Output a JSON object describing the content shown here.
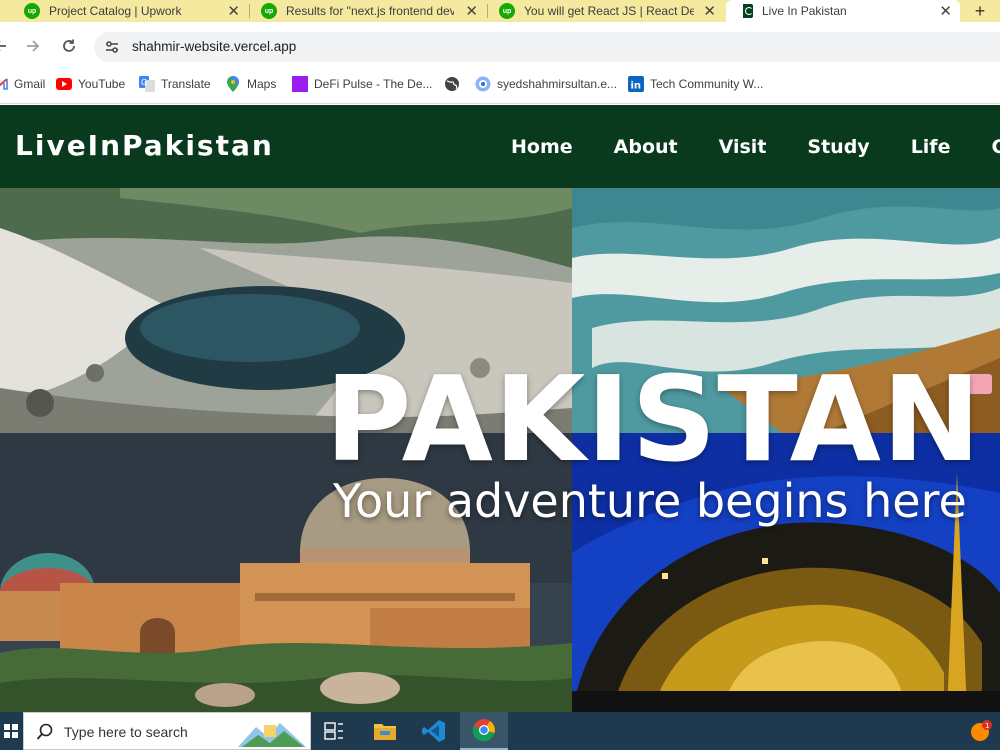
{
  "browser": {
    "tabs": [
      {
        "title": "Project Catalog | Upwork",
        "favicon": "upwork-icon",
        "favicon_text": "up"
      },
      {
        "title": "Results for \"next.js frontend dev",
        "favicon": "upwork-icon",
        "favicon_text": "up"
      },
      {
        "title": "You will get React JS | React Dev",
        "favicon": "upwork-icon",
        "favicon_text": "up"
      },
      {
        "title": "Live In Pakistan",
        "favicon": "pakistan-flag-icon",
        "active": true
      }
    ],
    "close_glyph": "✕",
    "new_tab_glyph": "+",
    "url": "shahmir-website.vercel.app",
    "bookmarks": [
      {
        "label": "Gmail",
        "icon": "gmail-icon"
      },
      {
        "label": "YouTube",
        "icon": "youtube-icon"
      },
      {
        "label": "Translate",
        "icon": "translate-icon"
      },
      {
        "label": "Maps",
        "icon": "maps-icon"
      },
      {
        "label": "DeFi Pulse - The De...",
        "icon": "defi-pulse-icon"
      },
      {
        "label": "",
        "icon": "globe-icon"
      },
      {
        "label": "syedshahmirsultan.e...",
        "icon": "profile-site-icon"
      },
      {
        "label": "Tech Community W...",
        "icon": "linkedin-icon"
      }
    ]
  },
  "site": {
    "brand": "LiveInPakistan",
    "nav": [
      "Home",
      "About",
      "Visit",
      "Study",
      "Life",
      "Con"
    ],
    "colors": {
      "header_bg": "#0a3a1e",
      "text": "#ffffff"
    }
  },
  "hero": {
    "title": "PAKISTAN",
    "subtitle": "Your adventure begins here",
    "panels": [
      "mountain-lake-photo",
      "beach-waves-photo",
      "historic-tomb-photo",
      "pakistan-monument-photo"
    ]
  },
  "taskbar": {
    "search_placeholder": "Type here to search",
    "apps": [
      "task-view-icon",
      "file-explorer-icon",
      "vscode-icon",
      "chrome-icon"
    ],
    "notification_count": "1"
  }
}
